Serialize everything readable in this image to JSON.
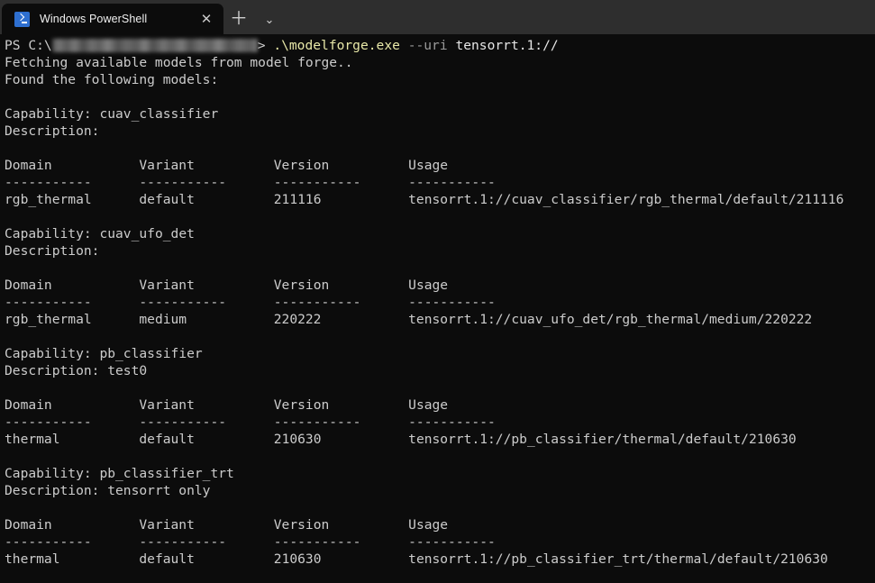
{
  "window": {
    "tab": {
      "title": "Windows PowerShell",
      "icon": "powershell-icon",
      "close_glyph": "✕"
    },
    "new_tab_glyph": "＋",
    "dropdown_glyph": "⌄"
  },
  "terminal": {
    "prompt": {
      "prefix": "PS C:\\",
      "redacted_path": "",
      "suffix": ">",
      "command": ".\\modelforge.exe",
      "param": "--uri",
      "argument": "tensorrt.1://"
    },
    "status_lines": [
      "Fetching available models from model forge..",
      "Found the following models:"
    ],
    "table_headers": {
      "domain": "Domain",
      "variant": "Variant",
      "version": "Version",
      "usage": "Usage",
      "rule": "-----------"
    },
    "capability_label": "Capability:",
    "description_label": "Description:",
    "sections": [
      {
        "capability": "cuav_classifier",
        "description": "",
        "rows": [
          {
            "domain": "rgb_thermal",
            "variant": "default",
            "version": "211116",
            "usage": "tensorrt.1://cuav_classifier/rgb_thermal/default/211116"
          }
        ]
      },
      {
        "capability": "cuav_ufo_det",
        "description": "",
        "rows": [
          {
            "domain": "rgb_thermal",
            "variant": "medium",
            "version": "220222",
            "usage": "tensorrt.1://cuav_ufo_det/rgb_thermal/medium/220222"
          }
        ]
      },
      {
        "capability": "pb_classifier",
        "description": "test0",
        "rows": [
          {
            "domain": "thermal",
            "variant": "default",
            "version": "210630",
            "usage": "tensorrt.1://pb_classifier/thermal/default/210630"
          }
        ]
      },
      {
        "capability": "pb_classifier_trt",
        "description": "tensorrt only",
        "rows": [
          {
            "domain": "thermal",
            "variant": "default",
            "version": "210630",
            "usage": "tensorrt.1://pb_classifier_trt/thermal/default/210630"
          }
        ]
      }
    ]
  },
  "colors": {
    "background": "#0c0c0c",
    "tabstrip": "#2e2e2e",
    "text": "#cccccc",
    "command": "#e8e8a8",
    "parameter": "#9a9a9a",
    "accent": "#2e6fd0"
  }
}
